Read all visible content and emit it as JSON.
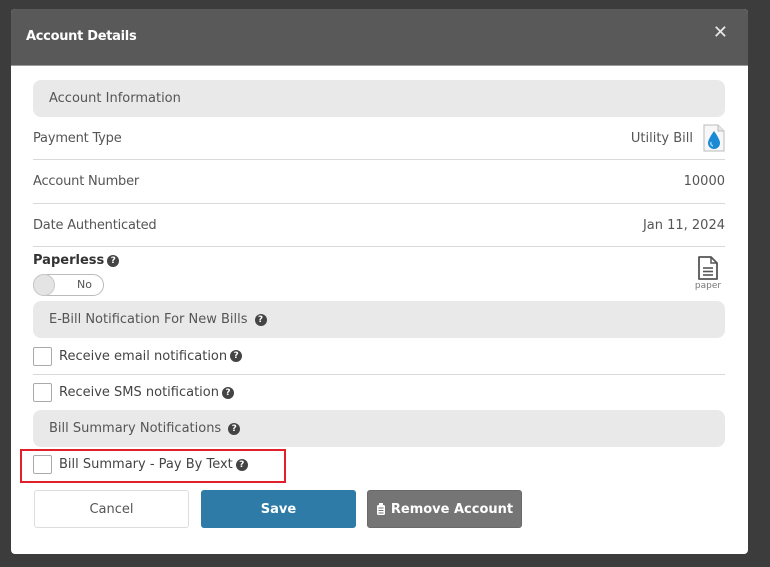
{
  "modal": {
    "title": "Account Details",
    "close_icon": "close-icon"
  },
  "account_info": {
    "section_title": "Account Information",
    "payment_type_label": "Payment Type",
    "payment_type_value": "Utility Bill",
    "payment_type_icon": "water-drop-document-icon",
    "account_number_label": "Account Number",
    "account_number_value": "10000",
    "date_authenticated_label": "Date Authenticated",
    "date_authenticated_value": "Jan 11, 2024"
  },
  "paperless": {
    "label": "Paperless",
    "help_icon": "?",
    "toggle_value": "No",
    "paper_icon_label": "paper"
  },
  "ebill": {
    "section_title": "E-Bill Notification For New Bills",
    "help_icon": "?",
    "options": [
      {
        "label": "Receive email notification",
        "checked": false
      },
      {
        "label": "Receive SMS notification",
        "checked": false
      }
    ]
  },
  "bill_summary": {
    "section_title": "Bill Summary Notifications",
    "help_icon": "?",
    "options": [
      {
        "label": "Bill Summary - Pay By Text",
        "checked": false,
        "highlighted": true
      }
    ]
  },
  "buttons": {
    "cancel": "Cancel",
    "save": "Save",
    "remove": "Remove Account"
  },
  "colors": {
    "header_bg": "#595959",
    "save_bg": "#2e7ba8",
    "remove_bg": "#757575",
    "highlight_border": "#e0212b",
    "water_drop": "#1a8ad4"
  }
}
